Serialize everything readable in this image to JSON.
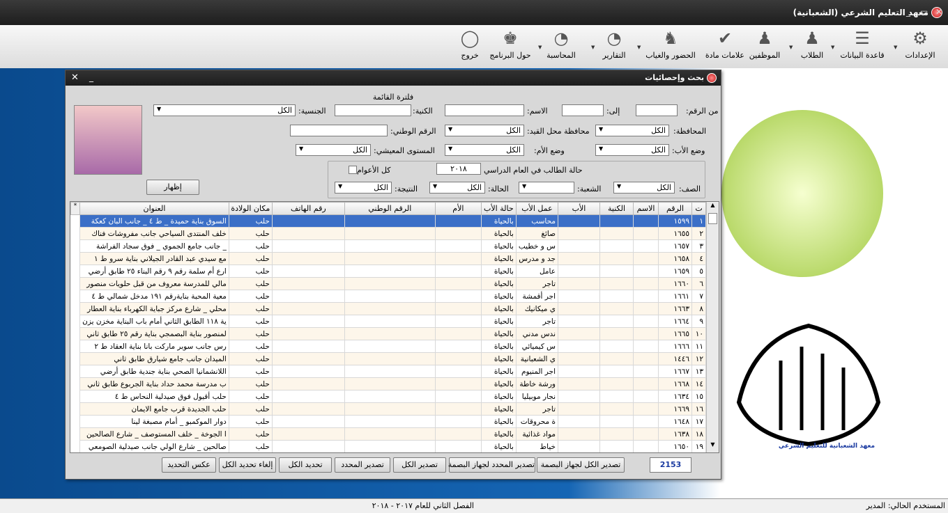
{
  "window": {
    "title": "معهد التعليم الشرعي (الشعبانية)",
    "min": "_",
    "restore": "▭",
    "close": "✕"
  },
  "ribbon": [
    {
      "label": "الإعدادات",
      "icon": "settings-icon",
      "glyph": "⚙"
    },
    {
      "label": "قاعدة البيانات",
      "icon": "database-icon",
      "glyph": "☰"
    },
    {
      "label": "الطلاب",
      "icon": "students-icon",
      "glyph": "👥"
    },
    {
      "label": "الموظفين",
      "icon": "employees-icon",
      "glyph": "👥"
    },
    {
      "label": "علامات مادة",
      "icon": "checkmark-icon",
      "glyph": "✔"
    },
    {
      "label": "الحضور والغياب",
      "icon": "attendance-icon",
      "glyph": "♟"
    },
    {
      "label": "التقارير",
      "icon": "reports-icon",
      "glyph": "◔"
    },
    {
      "label": "المحاسبة",
      "icon": "accounting-icon",
      "glyph": "◔"
    },
    {
      "label": "حول البرنامج",
      "icon": "about-icon",
      "glyph": "♚"
    },
    {
      "label": "خروج",
      "icon": "exit-icon",
      "glyph": "◯"
    }
  ],
  "dialog": {
    "title": "بحث وإحصائيات",
    "filter_title": "فلترة القائمة",
    "labels": {
      "from_num": "من الرقم:",
      "to": "إلى:",
      "name": "الاسم:",
      "nick": "الكنية:",
      "nationality": "الجنسية:",
      "governorate": "المحافظة:",
      "reg_gov": "محافظة محل القيد:",
      "national_id": "الرقم الوطني:",
      "father_status": "وضع الأب:",
      "mother_status": "وضع الأم:",
      "living": "المستوى المعيشي:",
      "student_status": "حالة الطالب في العام الدراسي",
      "all_years": "كل الأعوام",
      "class": "الصف:",
      "section": "الشعبة:",
      "status": "الحالة:",
      "result": "النتيجة:"
    },
    "values": {
      "from_num": "",
      "to": "",
      "name": "",
      "nick": "",
      "nationality": "الكل",
      "governorate": "الكل",
      "reg_gov": "الكل",
      "national_id": "",
      "father_status": "الكل",
      "mother_status": "الكل",
      "living": "الكل",
      "year": "٢٠١٨",
      "class": "الكل",
      "section": "",
      "status": "الكل",
      "result": "الكل"
    },
    "show_button": "إظهار",
    "count": "2153",
    "buttons": [
      "تصدير الكل لجهاز البصمة",
      "تصدير المحدد لجهاز البصمة",
      "تصدير الكل",
      "تصدير المحدد",
      "تحديد الكل",
      "إلغاء تحديد الكل",
      "عكس التحديد"
    ]
  },
  "grid": {
    "columns": [
      "ت",
      "الرقم",
      "الاسم",
      "الكنية",
      "الأب",
      "عمل الأب",
      "حالة الأب",
      "الأم",
      "الرقم الوطني",
      "رقم الهاتف",
      "مكان الولادة",
      "العنوان"
    ],
    "rows": [
      [
        "١",
        "١٥٩٩",
        "",
        "",
        "",
        "محاسب",
        "بالحياة",
        "",
        "",
        "",
        "حلب",
        "السوق بناية حميدة _ ط ٤ _ جانب البان كعكة"
      ],
      [
        "٢",
        "١٦٥٥",
        "",
        "",
        "",
        "صائغ",
        "بالحياة",
        "",
        "",
        "",
        "حلب",
        "خلف المنتدى السياحي جانب مفروشات فناك"
      ],
      [
        "٣",
        "١٦٥٧",
        "",
        "",
        "",
        "س و خطيب",
        "بالحياة",
        "",
        "",
        "",
        "حلب",
        "_ جانب جامع الجموي _ فوق سجاد الفراشة"
      ],
      [
        "٤",
        "١٦٥٨",
        "",
        "",
        "",
        "جد و مدرس",
        "بالحياة",
        "",
        "",
        "",
        "حلب",
        "مع سيدي عبد القادر الجيلاني بناية سرو ط ١"
      ],
      [
        "٥",
        "١٦٥٩",
        "",
        "",
        "",
        "عامل",
        "بالحياة",
        "",
        "",
        "",
        "حلب",
        "ارع أم سلمة رقم ٩ رقم البناء ٢٥ طابق أرضي"
      ],
      [
        "٦",
        "١٦٦٠",
        "",
        "",
        "",
        "تاجر",
        "بالحياة",
        "",
        "",
        "",
        "حلب",
        "مالي للمدرسة معروف من قبل حلويات منصور"
      ],
      [
        "٧",
        "١٦٦١",
        "",
        "",
        "",
        "اجر أقمشة",
        "بالحياة",
        "",
        "",
        "",
        "حلب",
        "معية المحبة بنايةرقم ١٩١ مدخل شمالي ط ٤"
      ],
      [
        "٨",
        "١٦٦٣",
        "",
        "",
        "",
        "ي ميكانيك",
        "بالحياة",
        "",
        "",
        "",
        "حلب",
        "محلي _ شارع مركز جباية الكهرباء بناية العطار"
      ],
      [
        "٩",
        "١٦٦٤",
        "",
        "",
        "",
        "تاجر",
        "بالحياة",
        "",
        "",
        "",
        "حلب",
        "ية ١١٨ الطابق الثاني أمام باب البناية مخزن يزن"
      ],
      [
        "١٠",
        "١٦٦٥",
        "",
        "",
        "",
        "ندس مدني",
        "بالحياة",
        "",
        "",
        "",
        "حلب",
        "لمنصور بناية البصمجي بناية رقم ٢٥ طابق ثاني"
      ],
      [
        "١١",
        "١٦٦٦",
        "",
        "",
        "",
        "س كيميائي",
        "بالحياة",
        "",
        "",
        "",
        "حلب",
        "رس جانب سوبر ماركت بانا بناية العقاد ط ٢"
      ],
      [
        "١٢",
        "١٤٤٦",
        "",
        "",
        "",
        "ي الشعبانية",
        "بالحياة",
        "",
        "",
        "",
        "حلب",
        "الميدان جانب جامع شيارق طابق ثاني"
      ],
      [
        "١٣",
        "١٦٦٧",
        "",
        "",
        "",
        "اجر المنيوم",
        "بالحياة",
        "",
        "",
        "",
        "حلب",
        "اللانشمانيا الصحي بناية جندية طابق أرضي"
      ],
      [
        "١٤",
        "١٦٦٨",
        "",
        "",
        "",
        "ورشة خاطة",
        "بالحياة",
        "",
        "",
        "",
        "حلب",
        "ب مدرسة محمد حداد بناية الجربوع طابق ثاني"
      ],
      [
        "١٥",
        "١٦٣٤",
        "",
        "",
        "",
        "نجار موبيليا",
        "بالحياة",
        "",
        "",
        "",
        "حلب",
        "حلب أقيول فوق صيدلية النحاس ط ٤"
      ],
      [
        "١٦",
        "١٦٦٩",
        "",
        "",
        "",
        "تاجر",
        "بالحياة",
        "",
        "",
        "",
        "حلب",
        "حلب الجديدة قرب جامع الايمان"
      ],
      [
        "١٧",
        "١٦٤٨",
        "",
        "",
        "",
        "ة محروقات",
        "بالحياة",
        "",
        "",
        "",
        "حلب",
        "دوار الموكمبو _ أمام مصبغة لينا"
      ],
      [
        "١٨",
        "١٦٣٨",
        "",
        "",
        "",
        "مواد غذائية",
        "بالحياة",
        "",
        "",
        "",
        "حلب",
        "ا الجوخة _ خلف المستوصف _ شارع الصالحين"
      ],
      [
        "١٩",
        "١٦٥٠",
        "",
        "",
        "",
        "خياط",
        "بالحياة",
        "",
        "",
        "",
        "حلب",
        "صالحين _ شارع الولي جانب صيدلية الصومعي"
      ]
    ]
  },
  "status": {
    "user": "المستخدم الحالي: المدير",
    "term": "الفصل الثاني للعام ٢٠١٧ - ٢٠١٨"
  },
  "logo": {
    "caption": "معهد الشعبانية للتعليم الشرعي"
  },
  "colors": {
    "accent": "#3b6fc7",
    "titlebar": "#2a2a2a",
    "desktop": "#0a4f95"
  }
}
